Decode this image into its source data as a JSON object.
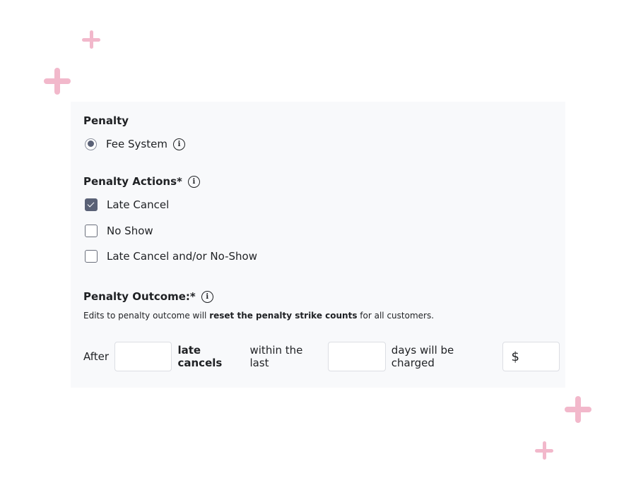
{
  "penalty": {
    "title": "Penalty",
    "option_label": "Fee System",
    "option_selected": true
  },
  "actions": {
    "title": "Penalty Actions*",
    "items": [
      {
        "label": "Late Cancel",
        "checked": true
      },
      {
        "label": "No Show",
        "checked": false
      },
      {
        "label": "Late Cancel and/or No-Show",
        "checked": false
      }
    ]
  },
  "outcome": {
    "title": "Penalty Outcome:*",
    "note_pre": "Edits to penalty outcome will ",
    "note_bold": "reset the penalty strike counts",
    "note_post": " for all customers.",
    "after_label": "After",
    "count_value": "",
    "bold_label": "late cancels",
    "within_label": "within the last",
    "days_value": "",
    "charged_label": "days will be charged",
    "currency_symbol": "$",
    "amount_value": ""
  },
  "icons": {
    "info": "i"
  },
  "colors": {
    "accent": "#5a6176",
    "sparkle": "#f2b8cb",
    "card_bg": "#f8f9fb"
  }
}
